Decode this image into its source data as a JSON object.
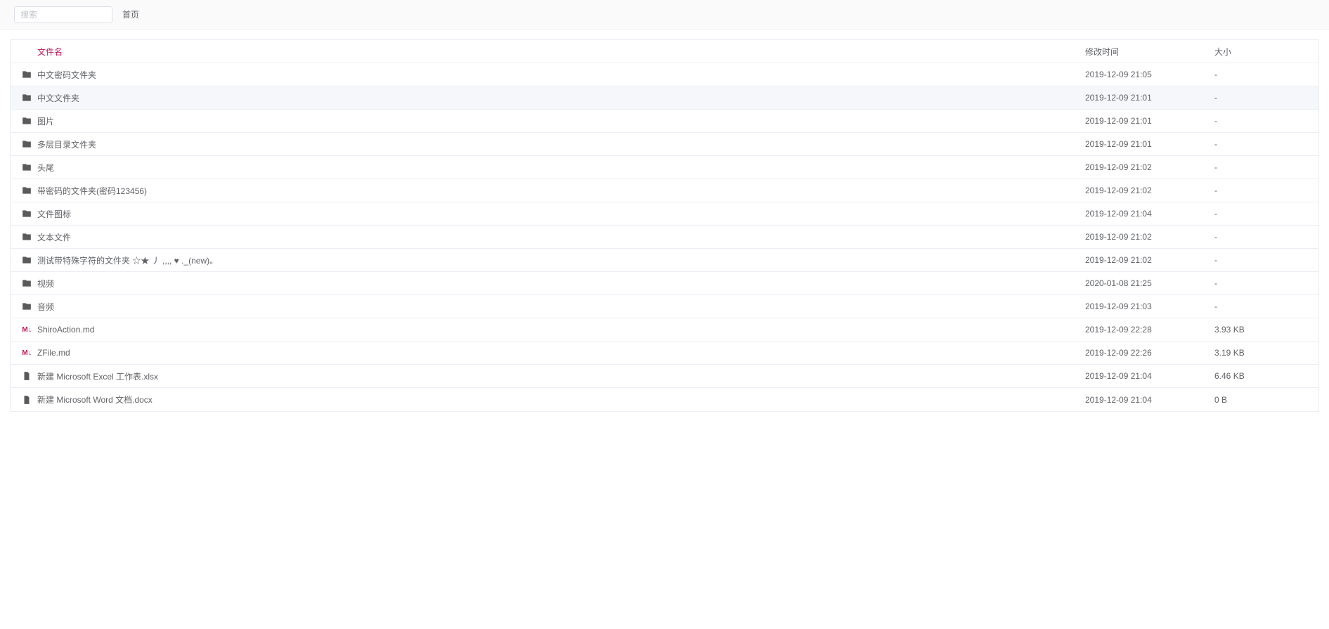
{
  "search": {
    "placeholder": "搜索"
  },
  "breadcrumb": {
    "home": "首页"
  },
  "columns": {
    "name": "文件名",
    "mtime": "修改时间",
    "size": "大小"
  },
  "hovered_index": 1,
  "rows": [
    {
      "icon": "folder",
      "name": "中文密码文件夹",
      "mtime": "2019-12-09 21:05",
      "size": "-"
    },
    {
      "icon": "folder",
      "name": "中文文件夹",
      "mtime": "2019-12-09 21:01",
      "size": "-"
    },
    {
      "icon": "folder",
      "name": "图片",
      "mtime": "2019-12-09 21:01",
      "size": "-"
    },
    {
      "icon": "folder",
      "name": "多层目录文件夹",
      "mtime": "2019-12-09 21:01",
      "size": "-"
    },
    {
      "icon": "folder",
      "name": "头尾",
      "mtime": "2019-12-09 21:02",
      "size": "-"
    },
    {
      "icon": "folder",
      "name": "带密码的文件夹(密码123456)",
      "mtime": "2019-12-09 21:02",
      "size": "-"
    },
    {
      "icon": "folder",
      "name": "文件图标",
      "mtime": "2019-12-09 21:04",
      "size": "-"
    },
    {
      "icon": "folder",
      "name": "文本文件",
      "mtime": "2019-12-09 21:02",
      "size": "-"
    },
    {
      "icon": "folder",
      "name": "测试带特殊字符的文件夹 ☆★ 丿 ,,,, ♥ ._(new)。",
      "mtime": "2019-12-09 21:02",
      "size": "-"
    },
    {
      "icon": "folder",
      "name": "视频",
      "mtime": "2020-01-08 21:25",
      "size": "-"
    },
    {
      "icon": "folder",
      "name": "音频",
      "mtime": "2019-12-09 21:03",
      "size": "-"
    },
    {
      "icon": "md",
      "name": "ShiroAction.md",
      "mtime": "2019-12-09 22:28",
      "size": "3.93 KB"
    },
    {
      "icon": "md",
      "name": "ZFile.md",
      "mtime": "2019-12-09 22:26",
      "size": "3.19 KB"
    },
    {
      "icon": "file",
      "name": "新建 Microsoft Excel 工作表.xlsx",
      "mtime": "2019-12-09 21:04",
      "size": "6.46 KB"
    },
    {
      "icon": "file",
      "name": "新建 Microsoft Word 文档.docx",
      "mtime": "2019-12-09 21:04",
      "size": "0 B"
    }
  ]
}
